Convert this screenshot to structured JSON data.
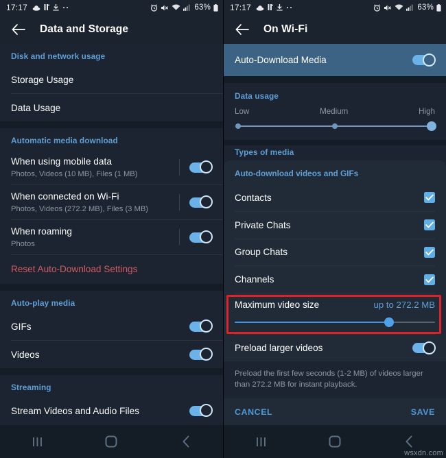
{
  "status_bar": {
    "time": "17:17",
    "left_icons": [
      "cloud-icon",
      "paused-icon",
      "download-icon",
      "more-dots-icon"
    ],
    "right_icons": [
      "alarm-icon",
      "mute-icon",
      "wifi-icon",
      "signal-icon"
    ],
    "battery": "63%"
  },
  "left_screen": {
    "appbar": {
      "back_icon": "back-arrow-icon",
      "title": "Data and Storage"
    },
    "sections": [
      {
        "header": "Disk and network usage",
        "rows": [
          {
            "title": "Storage Usage"
          },
          {
            "title": "Data Usage"
          }
        ]
      },
      {
        "header": "Automatic media download",
        "rows": [
          {
            "title": "When using mobile data",
            "subtitle": "Photos, Videos (10 MB), Files (1 MB)",
            "toggle": "on"
          },
          {
            "title": "When connected on Wi-Fi",
            "subtitle": "Photos, Videos (272.2 MB), Files (3 MB)",
            "toggle": "on"
          },
          {
            "title": "When roaming",
            "subtitle": "Photos",
            "toggle": "on"
          }
        ],
        "danger_action": "Reset Auto-Download Settings"
      },
      {
        "header": "Auto-play media",
        "rows": [
          {
            "title": "GIFs",
            "toggle": "on"
          },
          {
            "title": "Videos",
            "toggle": "on"
          }
        ]
      },
      {
        "header": "Streaming",
        "rows": [
          {
            "title": "Stream Videos and Audio Files",
            "toggle": "on"
          }
        ]
      }
    ]
  },
  "right_screen": {
    "appbar": {
      "back_icon": "back-arrow-icon",
      "title": "On Wi-Fi"
    },
    "master_toggle": {
      "label": "Auto-Download Media",
      "state": "on"
    },
    "data_usage": {
      "header": "Data usage",
      "ticks": [
        "Low",
        "Medium",
        "High"
      ],
      "selected": "High"
    },
    "types_of_media_header": "Types of media",
    "dialog": {
      "title": "Auto-download videos and GIFs",
      "checkboxes": [
        {
          "label": "Contacts",
          "checked": true
        },
        {
          "label": "Private Chats",
          "checked": true
        },
        {
          "label": "Group Chats",
          "checked": true
        },
        {
          "label": "Channels",
          "checked": true
        }
      ],
      "max_video_size": {
        "label": "Maximum video size",
        "value": "up to 272.2 MB",
        "slider_percent": 77,
        "highlighted": true
      },
      "preload": {
        "label": "Preload larger videos",
        "state": "on",
        "description": "Preload the first few seconds (1-2 MB) of videos larger than 272.2 MB for instant playback."
      },
      "actions": {
        "cancel": "CANCEL",
        "save": "SAVE"
      }
    }
  },
  "nav_bar": {
    "recents_icon": "recents-icon",
    "home_icon": "home-icon",
    "back_icon": "nav-back-icon"
  },
  "watermark": "wsxdn.com",
  "colors": {
    "accent_blue": "#5f9fd6",
    "toggle_on": "#6bb2e8",
    "highlight_row": "#3d6384",
    "danger_red": "#cf5c63",
    "annotation_red": "#e02128",
    "bg": "#1b2430",
    "bg_dark": "#141c26",
    "dialog_bg": "#212b38"
  }
}
